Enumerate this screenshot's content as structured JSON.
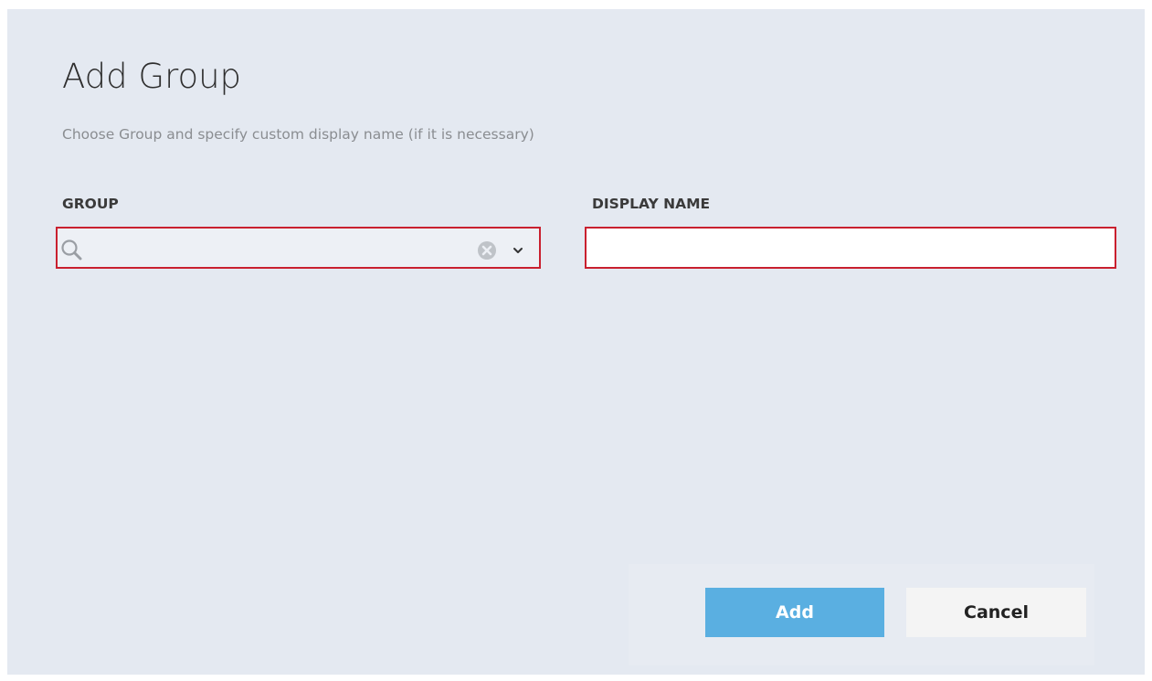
{
  "dialog": {
    "title": "Add Group",
    "subtitle": "Choose Group and specify custom display name (if it is necessary)"
  },
  "fields": {
    "group": {
      "label": "GROUP",
      "value": "",
      "placeholder": ""
    },
    "display_name": {
      "label": "DISPLAY NAME",
      "value": "",
      "placeholder": ""
    }
  },
  "buttons": {
    "add_label": "Add",
    "cancel_label": "Cancel"
  },
  "icons": {
    "search": "search-icon",
    "clear": "clear-icon",
    "dropdown": "chevron-down-icon"
  },
  "colors": {
    "dialog_background": "#e4e9f1",
    "invalid_border": "#c9202f",
    "primary_button": "#5aafe1",
    "secondary_button": "#f4f4f4"
  }
}
